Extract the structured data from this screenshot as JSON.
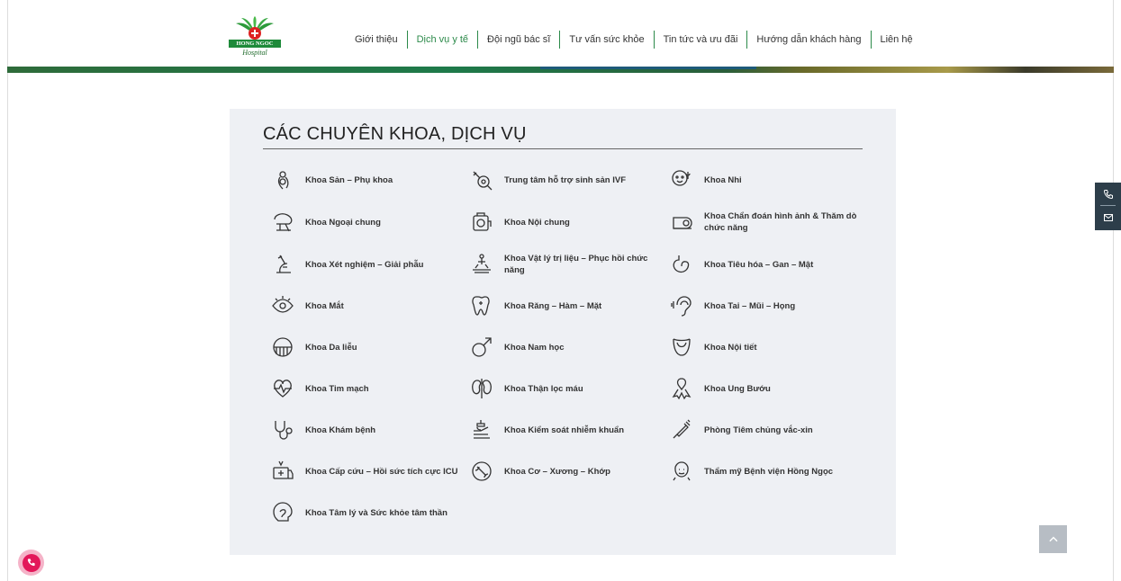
{
  "logo": {
    "brand": "HONG NGOC",
    "sub": "Hospital"
  },
  "nav": [
    {
      "label": "Giới thiệu",
      "active": false
    },
    {
      "label": "Dịch vụ y tế",
      "active": true
    },
    {
      "label": "Đội ngũ bác sĩ",
      "active": false
    },
    {
      "label": "Tư vấn sức khỏe",
      "active": false
    },
    {
      "label": "Tin tức và ưu đãi",
      "active": false
    },
    {
      "label": "Hướng dẫn khách hàng",
      "active": false
    },
    {
      "label": "Liên hệ",
      "active": false
    }
  ],
  "section": {
    "title": "CÁC CHUYÊN KHOA, DỊCH VỤ"
  },
  "services": [
    {
      "label": "Khoa Sản – Phụ khoa",
      "icon": "pregnancy-icon"
    },
    {
      "label": "Trung tâm hỗ trợ sinh sản IVF",
      "icon": "ivf-icon"
    },
    {
      "label": "Khoa Nhi",
      "icon": "child-icon"
    },
    {
      "label": "Khoa Ngoại chung",
      "icon": "surgery-icon"
    },
    {
      "label": "Khoa Nội chung",
      "icon": "internal-medicine-icon"
    },
    {
      "label": "Khoa Chẩn đoán hình ảnh & Thăm dò chức năng",
      "icon": "imaging-icon"
    },
    {
      "label": "Khoa Xét nghiệm – Giải phẫu",
      "icon": "microscope-icon"
    },
    {
      "label": "Khoa Vật lý trị liệu – Phục hồi chức năng",
      "icon": "physiotherapy-icon"
    },
    {
      "label": "Khoa Tiêu hóa – Gan – Mật",
      "icon": "stomach-icon"
    },
    {
      "label": "Khoa Mắt",
      "icon": "eye-icon"
    },
    {
      "label": "Khoa Răng – Hàm – Mặt",
      "icon": "tooth-icon"
    },
    {
      "label": "Khoa Tai – Mũi – Họng",
      "icon": "ear-icon"
    },
    {
      "label": "Khoa Da liễu",
      "icon": "skin-icon"
    },
    {
      "label": "Khoa Nam học",
      "icon": "male-icon"
    },
    {
      "label": "Khoa Nội tiết",
      "icon": "thyroid-icon"
    },
    {
      "label": "Khoa Tim mạch",
      "icon": "heart-icon"
    },
    {
      "label": "Khoa Thận lọc máu",
      "icon": "kidney-icon"
    },
    {
      "label": "Khoa Ung Bướu",
      "icon": "ribbon-icon"
    },
    {
      "label": "Khoa Khám bệnh",
      "icon": "stethoscope-icon"
    },
    {
      "label": "Khoa Kiểm soát nhiễm khuẩn",
      "icon": "handwash-icon"
    },
    {
      "label": "Phòng Tiêm chủng vắc-xin",
      "icon": "syringe-icon"
    },
    {
      "label": "Khoa Cấp cứu – Hồi sức tích cực ICU",
      "icon": "ambulance-icon"
    },
    {
      "label": "Khoa Cơ – Xương – Khớp",
      "icon": "bone-icon"
    },
    {
      "label": "Thẩm mỹ Bệnh viện Hồng Ngọc",
      "icon": "face-icon"
    },
    {
      "label": "Khoa Tâm lý và Sức khỏe tâm thần",
      "icon": "mind-icon"
    }
  ]
}
